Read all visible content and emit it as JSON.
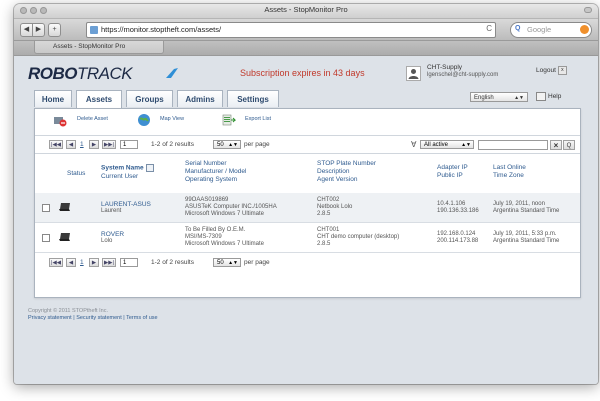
{
  "browser": {
    "window_title": "Assets - StopMonitor Pro",
    "url": "https://monitor.stoptheft.com/assets/",
    "search_placeholder": "Google",
    "tab_title": "Assets - StopMonitor Pro",
    "back_label": "◀",
    "forward_label": "▶",
    "add_label": "+",
    "refresh_label": "C"
  },
  "header": {
    "logo_bold": "ROBO",
    "logo_thin": "TRACK",
    "subscription": "Subscription expires in 43 days",
    "user_name": "CHT-Supply",
    "user_email": "lgenschel@cht-supply.com",
    "logout": "Logout",
    "language": "English",
    "help": "Help"
  },
  "nav": {
    "tabs": [
      "Home",
      "Assets",
      "Groups",
      "Admins",
      "Settings"
    ],
    "active": "Assets"
  },
  "actions": [
    "Delete Asset",
    "Map View",
    "Export List"
  ],
  "pager": {
    "first": "|◀◀",
    "prev": "◀",
    "page_link": "1",
    "next": "▶",
    "last": "▶▶|",
    "current_page": "1",
    "results": "1-2 of 2 results",
    "per_page_value": "50",
    "per_page_label": "per page"
  },
  "filter": {
    "value": "All active",
    "clear": "×",
    "search": "Q"
  },
  "table": {
    "headers": {
      "status": "Status",
      "name_1": "System Name",
      "name_2": "Current User",
      "serial_1": "Serial Number",
      "serial_2": "Manufacturer / Model",
      "serial_3": "Operating System",
      "plate_1": "STOP Plate Number",
      "plate_2": "Description",
      "plate_3": "Agent Version",
      "ip_1": "Adapter IP",
      "ip_2": "Public IP",
      "online_1": "Last Online",
      "online_2": "Time Zone"
    },
    "rows": [
      {
        "name": "LAURENT-ASUS",
        "user": "Laurent",
        "serial": "99OAAS019869",
        "model": "ASUSTeK Computer INC./1005HA",
        "os": "Microsoft Windows 7 Ultimate",
        "plate": "CHT002",
        "desc": "Netbook Lolo",
        "agent": "2.8.5",
        "adapter_ip": "10.4.1.106",
        "public_ip": "190.136.33.186",
        "last_online": "July 19, 2011, noon",
        "tz": "Argentina Standard Time"
      },
      {
        "name": "ROVER",
        "user": "Lolo",
        "serial": "To Be Filled By O.E.M.",
        "model": "MSI/MS-7309",
        "os": "Microsoft Windows 7 Ultimate",
        "plate": "CHT001",
        "desc": "CHT demo computer (desktop)",
        "agent": "2.8.5",
        "adapter_ip": "192.168.0.124",
        "public_ip": "200.114.173.88",
        "last_online": "July 19, 2011, 5:33 p.m.",
        "tz": "Argentina Standard Time"
      }
    ]
  },
  "footer": {
    "copyright": "Copyright © 2011 STOPtheft Inc.",
    "links": "Privacy statement | Security statement | Terms of use"
  },
  "colors": {
    "logo": "#1d2a45",
    "accent_swoosh": "#2f8fd6",
    "subscription": "#c0392b",
    "link": "#2f5b8f",
    "page_bg": "#dde2e8"
  }
}
